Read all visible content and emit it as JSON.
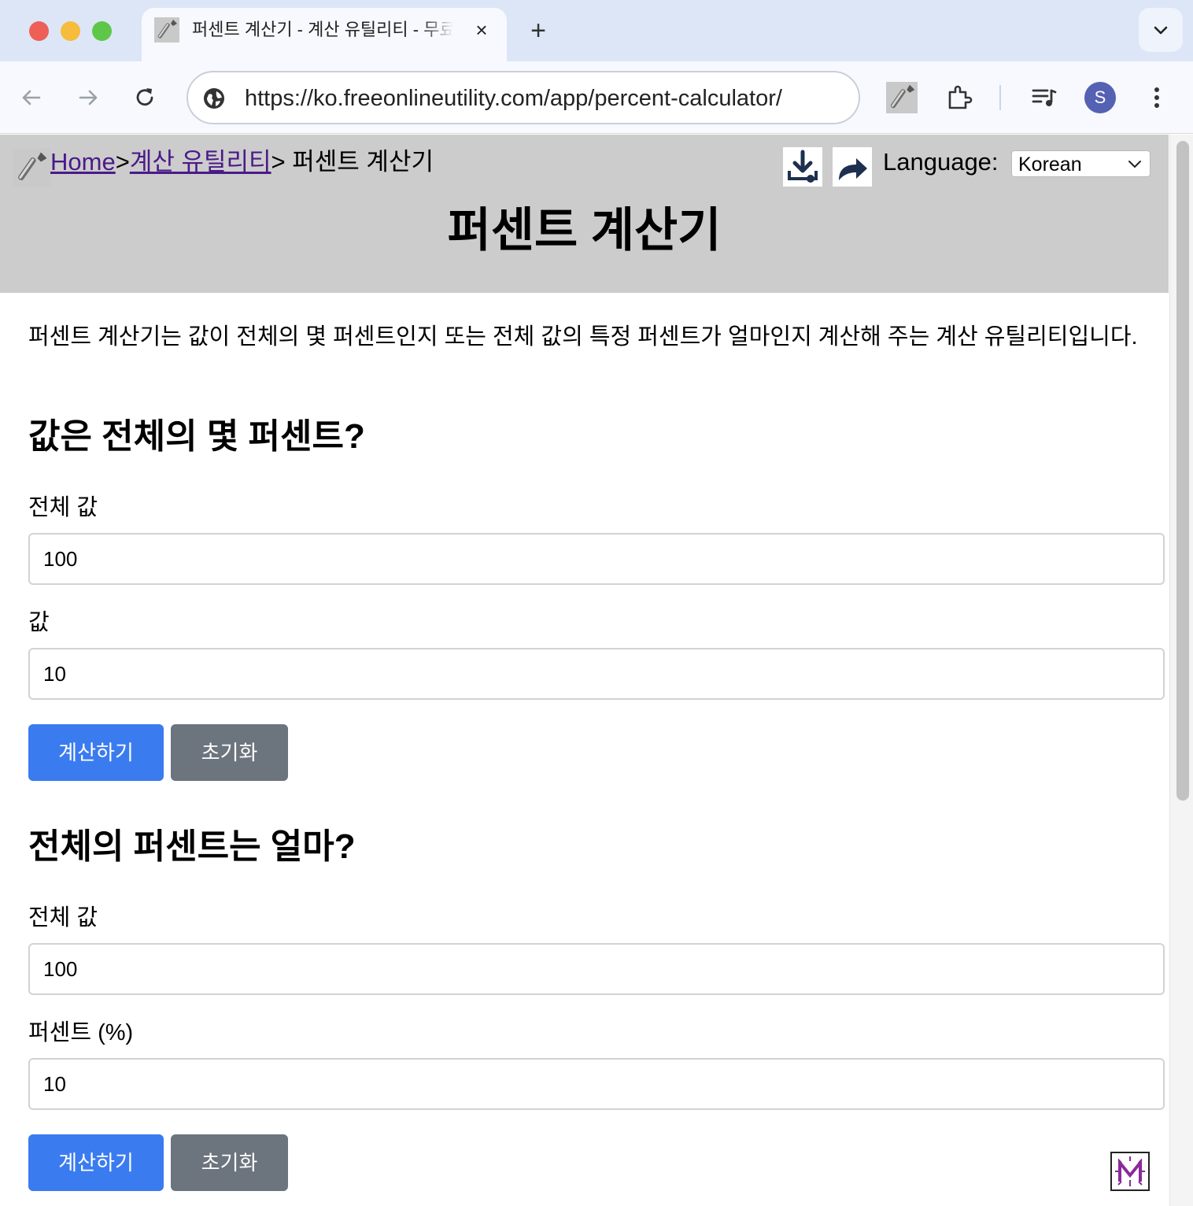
{
  "browser": {
    "tab_title": "퍼센트 계산기 - 계산 유틸리티 - 무료 온라인 유틸리티",
    "tab_close": "×",
    "new_tab": "+",
    "url": "https://ko.freeonlineutility.com/app/percent-calculator/",
    "profile_initial": "S",
    "colors": {
      "tabstrip": "#dde6f7",
      "toolbar": "#f7f9fe",
      "avatar": "#5561b3"
    }
  },
  "header": {
    "breadcrumb": {
      "home": "Home",
      "sep1": ">",
      "category": "계산 유틸리티",
      "current": "> 퍼센트 계산기"
    },
    "language_label": "Language:",
    "language_selected": "Korean",
    "title": "퍼센트 계산기",
    "colors": {
      "background": "#cccccc",
      "link": "#4a1a88"
    }
  },
  "intro": "퍼센트 계산기는 값이 전체의 몇 퍼센트인지 또는 전체 값의 특정 퍼센트가 얼마인지 계산해 주는 계산 유틸리티입니다.",
  "section1": {
    "heading": "값은 전체의 몇 퍼센트?",
    "total_label": "전체 값",
    "total_value": "100",
    "value_label": "값",
    "value_value": "10",
    "calculate_label": "계산하기",
    "reset_label": "초기화"
  },
  "section2": {
    "heading": "전체의 퍼센트는 얼마?",
    "total_label": "전체 값",
    "total_value": "100",
    "percent_label": "퍼센트 (%)",
    "percent_value": "10",
    "calculate_label": "계산하기",
    "reset_label": "초기화"
  },
  "colors": {
    "primary_button": "#3a7bf0",
    "secondary_button": "#6c747d"
  },
  "icons": [
    "wrench-icon",
    "back-arrow-icon",
    "forward-arrow-icon",
    "reload-icon",
    "site-info-icon",
    "extensions-icon",
    "media-control-icon",
    "menu-kebab-icon",
    "download-icon",
    "share-icon",
    "chevron-down-icon"
  ]
}
